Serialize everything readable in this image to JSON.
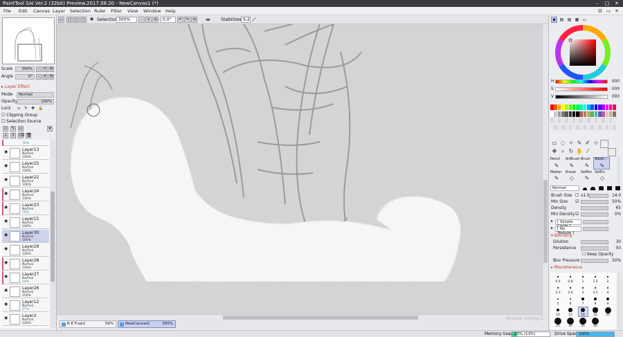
{
  "window": {
    "title": "PaintTool SAI Ver.2 (32bit) Preview.2017.08.20 - NewCanvas1 (*)"
  },
  "menu": [
    "File",
    "Edit",
    "Canvas",
    "Layer",
    "Selection",
    "Ruler",
    "Filter",
    "View",
    "Window",
    "Help"
  ],
  "navigator": {
    "scale_label": "Scale",
    "scale_value": "300%",
    "angle_label": "Angle",
    "angle_value": "0°"
  },
  "layer_panel": {
    "effect_label": "Layer Effect",
    "mode_label": "Mode",
    "mode_value": "Normal",
    "opacity_label": "Opacity",
    "opacity_value": "100%",
    "lock_label": "Lock",
    "clipping_label": "Clipping Group",
    "selection_source_label": "Selection Source",
    "layers": [
      {
        "name": "Layer13",
        "mode": "Normal",
        "opacity": "100%"
      },
      {
        "name": "Layer25",
        "mode": "Normal",
        "opacity": "100%"
      },
      {
        "name": "Layer22",
        "mode": "Normal",
        "opacity": "100%"
      },
      {
        "name": "Layer24",
        "mode": "Normal",
        "opacity": "100%"
      },
      {
        "name": "Layer23",
        "mode": "Normal",
        "opacity": "76%"
      },
      {
        "name": "Layer15",
        "mode": "Normal",
        "opacity": "100%"
      },
      {
        "name": "Layer30",
        "mode": "Normal",
        "opacity": "100%"
      },
      {
        "name": "Layer29",
        "mode": "Normal",
        "opacity": "100%"
      },
      {
        "name": "Layer28",
        "mode": "Normal",
        "opacity": "100%"
      },
      {
        "name": "Layer27",
        "mode": "Normal",
        "opacity": "34%"
      },
      {
        "name": "Layer26",
        "mode": "Normal",
        "opacity": "100%"
      },
      {
        "name": "Layer12",
        "mode": "Normal",
        "opacity": "27%"
      },
      {
        "name": "Layer2",
        "mode": "Normal",
        "opacity": "100%"
      }
    ],
    "partial_top_opacity": "76%"
  },
  "canvas_toolbar": {
    "selection_label": "Selection",
    "zoom": "300%",
    "angle": "0.0°",
    "stabilizer_label": "Stabilizer",
    "stabilizer_value": "S-2"
  },
  "tabs": [
    {
      "name": "R E F.sai2",
      "zoom": "59%"
    },
    {
      "name": "NewCanvas1",
      "zoom": "300%"
    }
  ],
  "watermark": "Access Configu...",
  "color": {
    "h_label": "H",
    "h_value": "000",
    "s_label": "S",
    "s_value": "000",
    "v_label": "V",
    "v_value": "093"
  },
  "swatches": [
    "#ff0000",
    "#ff5500",
    "#ffaa00",
    "#ffff00",
    "#aaff00",
    "#55ff00",
    "#00ff00",
    "#00ff55",
    "#00ffaa",
    "#00ffff",
    "#00aaff",
    "#0055ff",
    "#0000ff",
    "#5500ff",
    "#aa00ff",
    "#ff00ff",
    "#ff00aa",
    "#ff0055",
    "#ffffff",
    "#cccccc",
    "#999999",
    "#777777",
    "#555555",
    "#333333",
    "#111111",
    "#000000",
    "#b35a5a",
    "#b3835a",
    "#b3b35a",
    "#5ab35a",
    "#5ab3b3",
    "#5a5ab3",
    "#b35ab3",
    "#e0c8b0",
    "#c8b090",
    "#907050"
  ],
  "tools": {
    "row1": [
      "Pencil",
      "AirBrush",
      "Brush",
      "Water..."
    ],
    "row2": [
      "Marker",
      "Eraser",
      "SelPen",
      "SelErs"
    ]
  },
  "brush_settings": {
    "blend_mode": "Normal",
    "brush_size_label": "Brush Size",
    "brush_size_mult": "x1.0",
    "brush_size_value": "14.0",
    "min_size_label": "Min Size",
    "min_size_value": "50%",
    "density_label": "Density",
    "density_value": "65",
    "min_density_label": "Min Density",
    "min_density_value": "0%",
    "shape_label": "[ Simple Circle ]",
    "texture_label": "[ No Texture ]",
    "blending_label": "Blending",
    "dilution_label": "Dilution",
    "dilution_value": "30",
    "persistence_label": "Persistence",
    "persistence_value": "50",
    "keep_opacity_label": "Keep Opacity",
    "blur_pressure_label": "Blur Pressure",
    "blur_pressure_value": "50%",
    "misc_label": "Miscellaneous"
  },
  "brush_sizes": [
    "0.6",
    "0.8",
    "1",
    "1.5",
    "2",
    "2.3",
    "2.6",
    "3",
    "3.5",
    "4",
    "5",
    "6",
    "7",
    "8",
    "9",
    "10",
    "12",
    "14",
    "16",
    "20",
    "25",
    "30",
    "35",
    "40"
  ],
  "status": {
    "memory_label": "Memory Usage",
    "memory_value": "13% (13%)",
    "memory_fill": 0.13,
    "drive_label": "Drive Space",
    "drive_value": "100%",
    "drive_fill": 1.0
  }
}
